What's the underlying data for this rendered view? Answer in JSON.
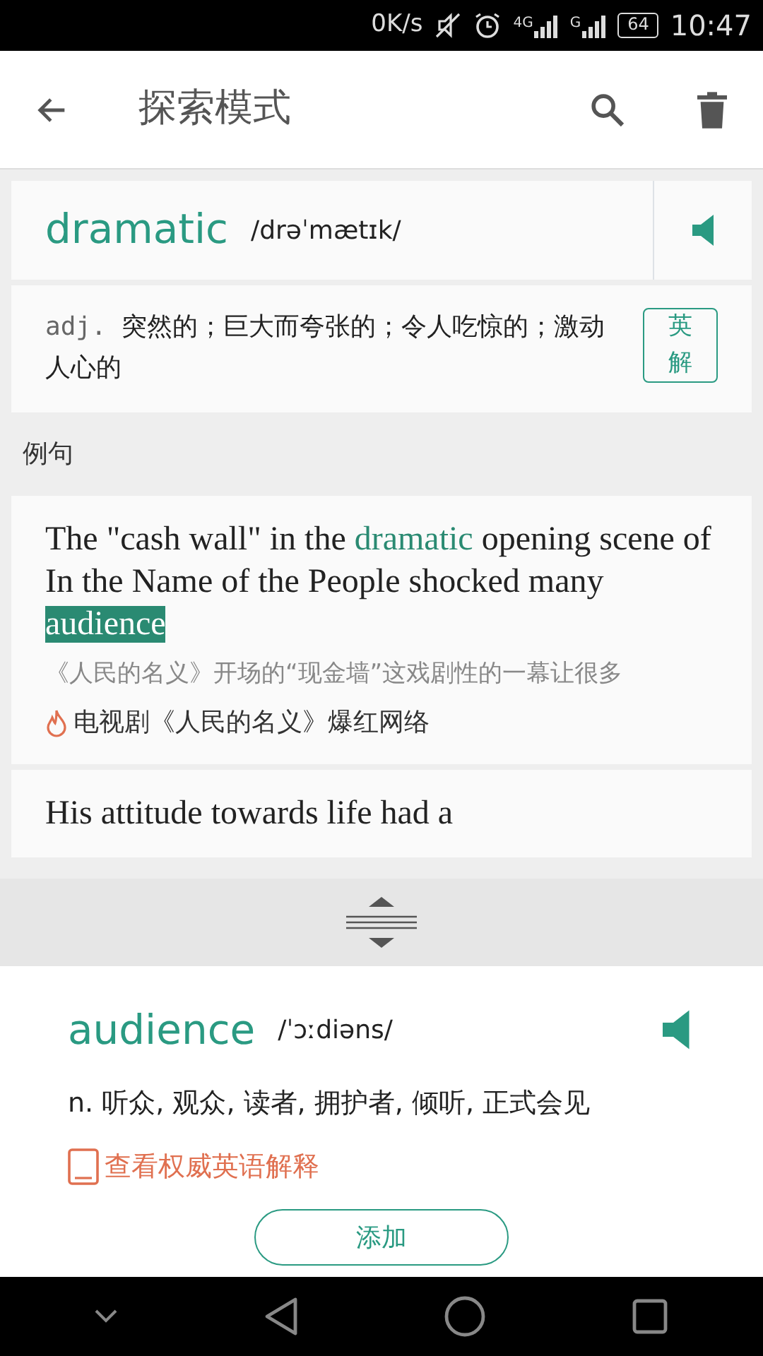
{
  "status_bar": {
    "speed": "0K/s",
    "network_1": "4G",
    "network_2": "G",
    "battery": "64",
    "time": "10:47"
  },
  "app_bar": {
    "title": "探索模式"
  },
  "word_card": {
    "word": "dramatic",
    "phonetic": "/drəˈmætɪk/",
    "pos": "adj.",
    "definition": "突然的；巨大而夸张的；令人吃惊的；激动人心的",
    "english_button": "英解"
  },
  "examples_header": "例句",
  "examples": [
    {
      "parts": [
        {
          "kind": "plain",
          "text": "The \"cash wall\" in the "
        },
        {
          "kind": "keyword",
          "text": "dramatic"
        },
        {
          "kind": "plain",
          "text": " opening scene of In the Name of the People shocked many "
        },
        {
          "kind": "lookup",
          "text": "audience"
        }
      ],
      "translation": "《人民的名义》开场的“现金墙”这戏剧性的一幕让很多",
      "source": "电视剧《人民的名义》爆红网络"
    },
    {
      "parts": [
        {
          "kind": "plain",
          "text": "His attitude towards life had a"
        }
      ]
    }
  ],
  "lookup_panel": {
    "word": "audience",
    "phonetic": "/ˈɔːdiəns/",
    "definition": "n. 听众, 观众, 读者, 拥护者, 倾听, 正式会见",
    "authority_link": "查看权威英语解释",
    "add_button": "添加"
  }
}
